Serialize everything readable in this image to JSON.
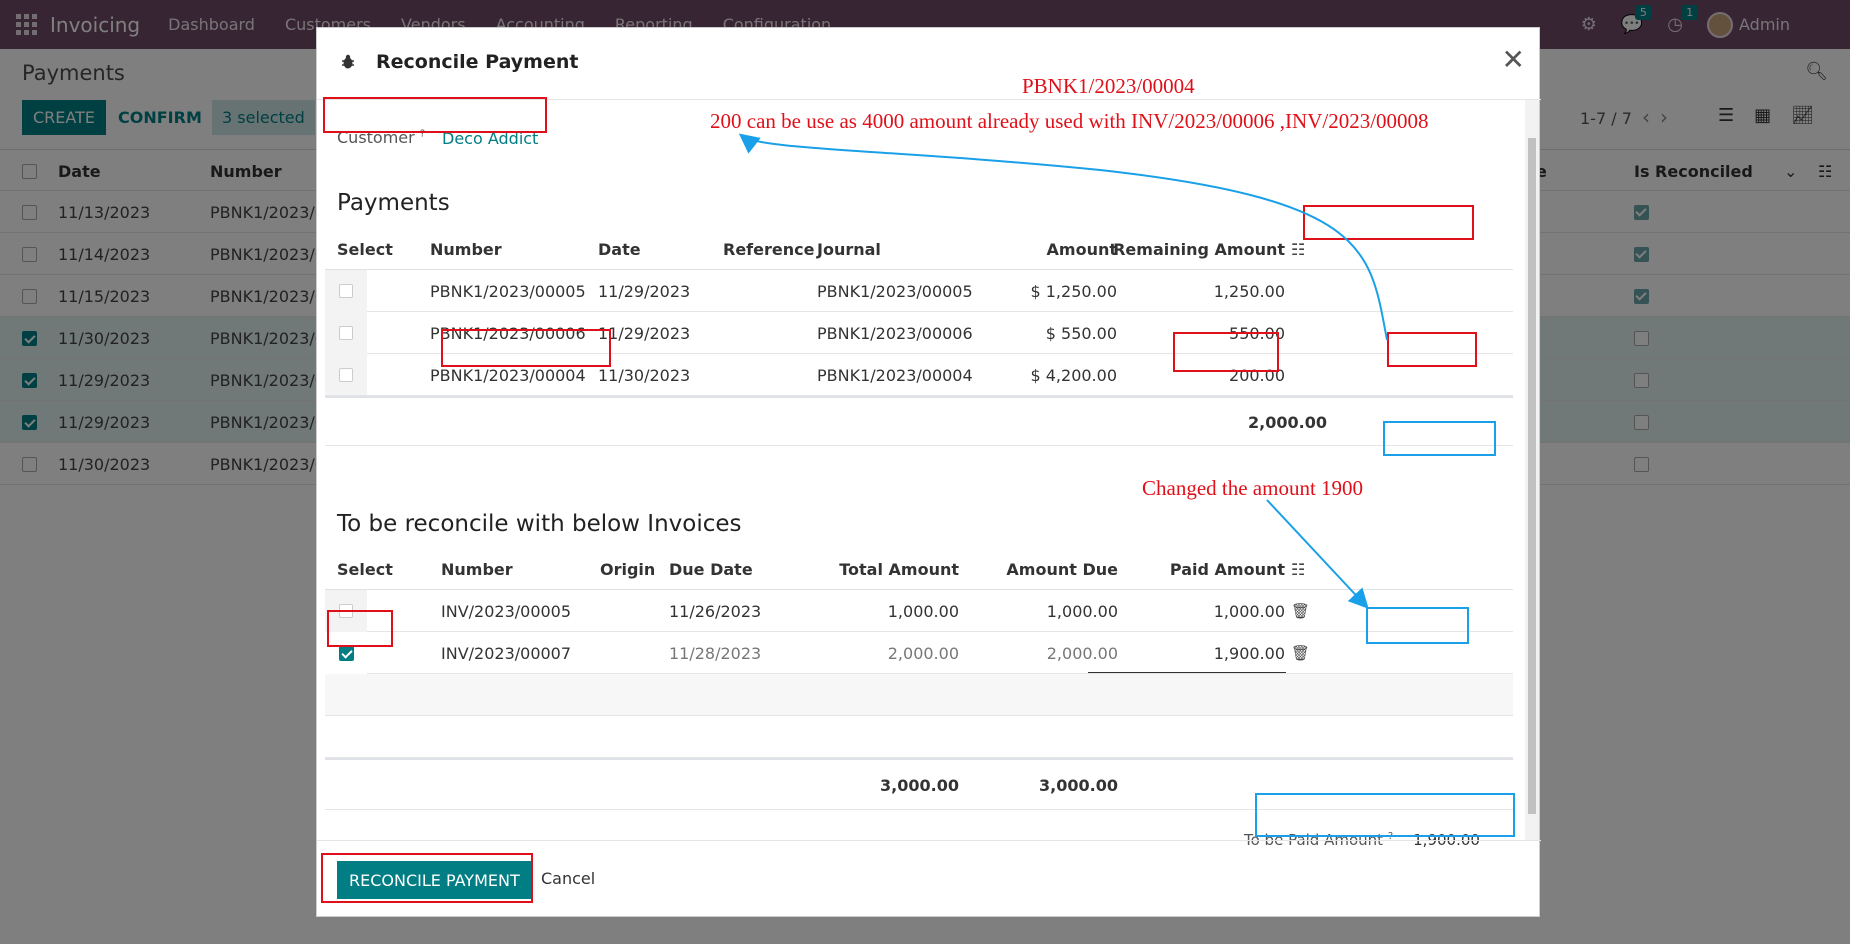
{
  "navbar": {
    "app_name": "Invoicing",
    "menu": [
      "Dashboard",
      "Customers",
      "Vendors",
      "Accounting",
      "Reporting",
      "Configuration"
    ],
    "messages_count": "5",
    "activities_count": "1",
    "user_name": "Admin"
  },
  "control_panel": {
    "breadcrumb": "Payments",
    "create_label": "CREATE",
    "confirm_label": "CONFIRM",
    "selected_label": "3 selected",
    "pager": "1-7 / 7"
  },
  "background_list": {
    "headers": {
      "date": "Date",
      "number": "Number",
      "partial_header": "e",
      "is_reconciled": "Is Reconciled"
    },
    "rows": [
      {
        "date": "11/13/2023",
        "number": "PBNK1/2023/0",
        "selected": false,
        "reconciled": true
      },
      {
        "date": "11/14/2023",
        "number": "PBNK1/2023/0",
        "selected": false,
        "reconciled": true
      },
      {
        "date": "11/15/2023",
        "number": "PBNK1/2023/0",
        "selected": false,
        "reconciled": true
      },
      {
        "date": "11/30/2023",
        "number": "PBNK1/2023/0",
        "selected": true,
        "reconciled": false
      },
      {
        "date": "11/29/2023",
        "number": "PBNK1/2023/0",
        "selected": true,
        "reconciled": false
      },
      {
        "date": "11/29/2023",
        "number": "PBNK1/2023/0",
        "selected": true,
        "reconciled": false
      },
      {
        "date": "11/30/2023",
        "number": "PBNK1/2023/0",
        "selected": false,
        "reconciled": false
      }
    ]
  },
  "modal": {
    "title": "Reconcile Payment",
    "customer_label": "Customer",
    "customer_help": "?",
    "customer_value": "Deco Addict",
    "payments_title": "Payments",
    "payments_headers": {
      "select": "Select",
      "number": "Number",
      "date": "Date",
      "reference": "Reference",
      "journal": "Journal",
      "amount": "Amount",
      "remaining": "Remaining Amount"
    },
    "payments": [
      {
        "number": "PBNK1/2023/00005",
        "date": "11/29/2023",
        "reference": "",
        "journal": "PBNK1/2023/00005",
        "amount": "$ 1,250.00",
        "remaining": "1,250.00"
      },
      {
        "number": "PBNK1/2023/00006",
        "date": "11/29/2023",
        "reference": "",
        "journal": "PBNK1/2023/00006",
        "amount": "$ 550.00",
        "remaining": "550.00"
      },
      {
        "number": "PBNK1/2023/00004",
        "date": "11/30/2023",
        "reference": "",
        "journal": "PBNK1/2023/00004",
        "amount": "$ 4,200.00",
        "remaining": "200.00"
      }
    ],
    "payments_total_remaining": "2,000.00",
    "invoices_title": "To be reconcile with below Invoices",
    "invoices_headers": {
      "select": "Select",
      "number": "Number",
      "origin": "Origin",
      "due_date": "Due Date",
      "total": "Total Amount",
      "due": "Amount Due",
      "paid": "Paid Amount"
    },
    "invoices": [
      {
        "number": "INV/2023/00005",
        "origin": "",
        "due_date": "11/26/2023",
        "total": "1,000.00",
        "due": "1,000.00",
        "paid": "1,000.00",
        "checked": false
      },
      {
        "number": "INV/2023/00007",
        "origin": "",
        "due_date": "11/28/2023",
        "total": "2,000.00",
        "due": "2,000.00",
        "paid": "1,900.00",
        "checked": true
      }
    ],
    "invoices_total_amount": "3,000.00",
    "invoices_total_due": "3,000.00",
    "to_be_paid_label": "To be Paid Amount",
    "to_be_paid_help": "?",
    "to_be_paid_value": "1,900.00",
    "reconcile_button": "RECONCILE PAYMENT",
    "cancel_button": "Cancel"
  },
  "annotations": {
    "note_payment_ref": "PBNK1/2023/00004",
    "note_remaining": "200 can be use as 4000 amount already used with INV/2023/00006 ,INV/2023/00008",
    "note_changed": "Changed the amount 1900",
    "red_color": "#e0101a",
    "blue_color": "#1aa0e8"
  },
  "colors": {
    "navbar": "#714b67",
    "primary": "#017e84"
  }
}
